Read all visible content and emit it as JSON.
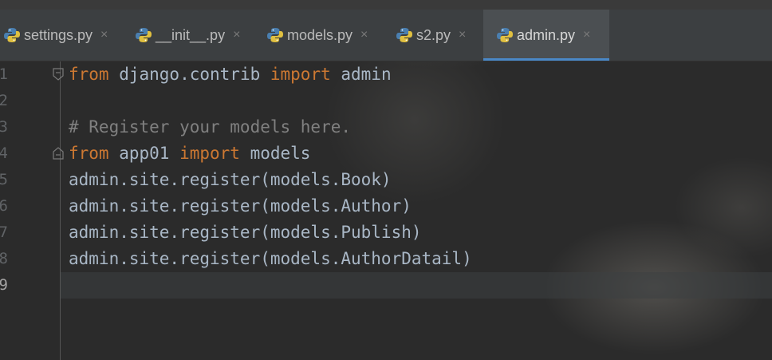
{
  "tabs": [
    {
      "label": "settings.py",
      "close": "×",
      "active": false
    },
    {
      "label": "__init__.py",
      "close": "×",
      "active": false
    },
    {
      "label": "models.py",
      "close": "×",
      "active": false
    },
    {
      "label": "s2.py",
      "close": "×",
      "active": false
    },
    {
      "label": "admin.py",
      "close": "×",
      "active": true
    }
  ],
  "editor": {
    "current_line": 9,
    "lines": [
      {
        "num": "1",
        "kw1": "from",
        "t1": " django.contrib ",
        "kw2": "import",
        "t2": " admin"
      },
      {
        "num": "2",
        "text": ""
      },
      {
        "num": "3",
        "comment": "# Register your models here."
      },
      {
        "num": "4",
        "kw1": "from",
        "t1": " app01 ",
        "kw2": "import",
        "t2": " models"
      },
      {
        "num": "5",
        "text": "admin.site.register(models.Book)"
      },
      {
        "num": "6",
        "text": "admin.site.register(models.Author)"
      },
      {
        "num": "7",
        "text": "admin.site.register(models.Publish)"
      },
      {
        "num": "8",
        "text": "admin.site.register(models.AuthorDatail)"
      },
      {
        "num": "9",
        "text": ""
      }
    ]
  },
  "colors": {
    "keyword": "#cc7832",
    "comment": "#808080",
    "text": "#a9b7c6",
    "tab_accent": "#4a88c7"
  },
  "icons": {
    "file_type": "python-file-icon",
    "fold": "fold-marker-icon",
    "close": "close-icon"
  }
}
